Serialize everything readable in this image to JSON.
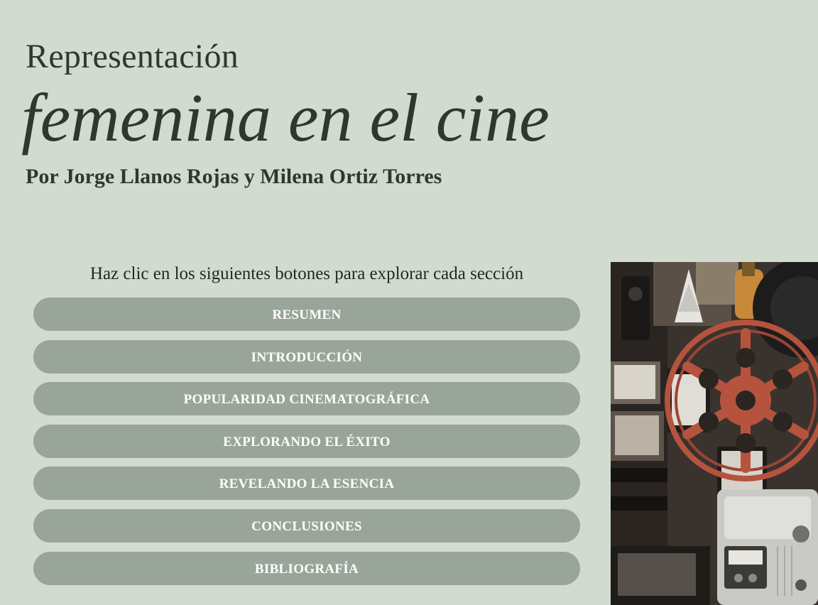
{
  "header": {
    "title_line1": "Representación",
    "title_line2": "femenina en el cine",
    "authors": "Por Jorge Llanos Rojas y Milena Ortiz Torres"
  },
  "main": {
    "instruction": "Haz clic en los siguientes botones para explorar cada sección",
    "buttons": [
      {
        "label": "RESUMEN"
      },
      {
        "label": "INTRODUCCIÓN"
      },
      {
        "label": "POPULARIDAD CINEMATOGRÁFICA"
      },
      {
        "label": "EXPLORANDO EL ÉXITO"
      },
      {
        "label": "REVELANDO LA ESENCIA"
      },
      {
        "label": "CONCLUSIONES"
      },
      {
        "label": "BIBLIOGRAFÍA"
      }
    ]
  },
  "photo": {
    "description_icon": "film-projector-reel-image"
  },
  "colors": {
    "background": "#d1dbd0",
    "button": "#9aa599",
    "button_text": "#ffffff",
    "heading": "#2d392f",
    "reel": "#b5533f"
  }
}
